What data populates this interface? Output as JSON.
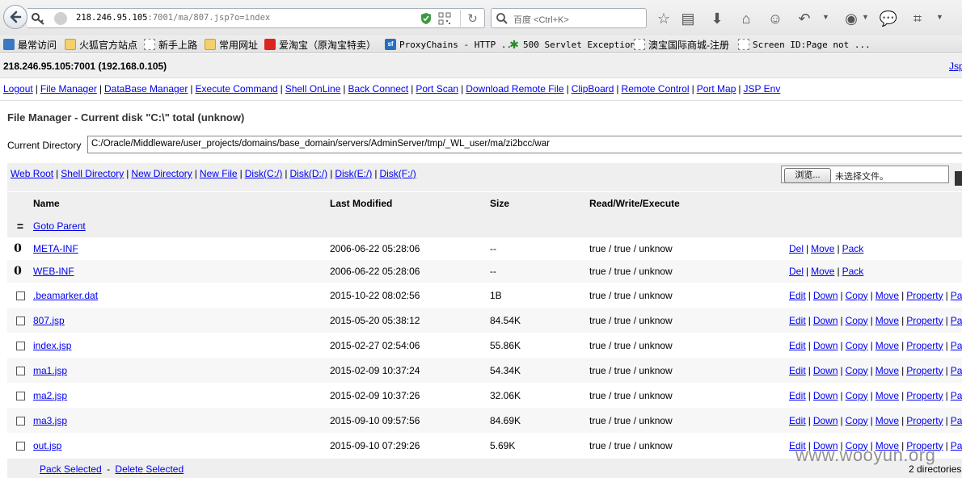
{
  "browser": {
    "url_host": "218.246.95.105",
    "url_rest": ":7001/ma/807.jsp?o=index",
    "search_placeholder": "百度 <Ctrl+K>"
  },
  "bookmarks": [
    {
      "label": "最常访问",
      "icon": "star-icon"
    },
    {
      "label": "火狐官方站点",
      "icon": "folder-icon"
    },
    {
      "label": "新手上路",
      "icon": "page-icon"
    },
    {
      "label": "常用网址",
      "icon": "folder-icon"
    },
    {
      "label": "爱淘宝（原淘宝特卖）",
      "icon": "taobao-icon"
    },
    {
      "label": "ProxyChains - HTTP ...",
      "icon": "sourceforge-icon"
    },
    {
      "label": "500 Servlet Exception",
      "icon": "gear-icon"
    },
    {
      "label": "澳宝国际商城-注册",
      "icon": "page-icon"
    },
    {
      "label": "Screen ID:Page not ...",
      "icon": "page-icon"
    }
  ],
  "page": {
    "host": "218.246.95.105:7001 (192.168.0.105)",
    "corner_link": "Jsp",
    "nav": [
      "Logout",
      "File Manager",
      "DataBase Manager",
      "Execute Command",
      "Shell OnLine",
      "Back Connect",
      "Port Scan",
      "Download Remote File",
      "ClipBoard",
      "Remote Control",
      "Port Map",
      "JSP Env"
    ],
    "title": "File Manager - Current disk \"C:\\\" total (unknow)",
    "current_dir_label": "Current Directory",
    "current_dir": "C:/Oracle/Middleware/user_projects/domains/base_domain/servers/AdminServer/tmp/_WL_user/ma/zi2bcc/war",
    "dir_links": [
      "Web Root",
      "Shell Directory",
      "New Directory",
      "New File",
      "Disk(C:/)",
      "Disk(D:/)",
      "Disk(E:/)",
      "Disk(F:/)"
    ],
    "upload": {
      "browse": "浏览...",
      "no_file": "未选择文件。"
    },
    "columns": [
      "Name",
      "Last Modified",
      "Size",
      "Read/Write/Execute"
    ],
    "parent": {
      "mark": "=",
      "label": "Goto Parent"
    },
    "dirs": [
      {
        "mark": "0",
        "name": "META-INF",
        "modified": "2006-06-22 05:28:06",
        "size": "--",
        "rwx": "true / true / unknow",
        "actions": [
          "Del",
          "Move",
          "Pack"
        ]
      },
      {
        "mark": "0",
        "name": "WEB-INF",
        "modified": "2006-06-22 05:28:06",
        "size": "--",
        "rwx": "true / true / unknow",
        "actions": [
          "Del",
          "Move",
          "Pack"
        ]
      }
    ],
    "files": [
      {
        "name": ".beamarker.dat",
        "modified": "2015-10-22 08:02:56",
        "size": "1B",
        "rwx": "true / true / unknow"
      },
      {
        "name": "807.jsp",
        "modified": "2015-05-20 05:38:12",
        "size": "84.54K",
        "rwx": "true / true / unknow"
      },
      {
        "name": "index.jsp",
        "modified": "2015-02-27 02:54:06",
        "size": "55.86K",
        "rwx": "true / true / unknow"
      },
      {
        "name": "ma1.jsp",
        "modified": "2015-02-09 10:37:24",
        "size": "54.34K",
        "rwx": "true / true / unknow"
      },
      {
        "name": "ma2.jsp",
        "modified": "2015-02-09 10:37:26",
        "size": "32.06K",
        "rwx": "true / true / unknow"
      },
      {
        "name": "ma3.jsp",
        "modified": "2015-09-10 09:57:56",
        "size": "84.69K",
        "rwx": "true / true / unknow"
      },
      {
        "name": "out.jsp",
        "modified": "2015-09-10 07:29:26",
        "size": "5.69K",
        "rwx": "true / true / unknow"
      }
    ],
    "file_actions": [
      "Edit",
      "Down",
      "Copy",
      "Move",
      "Property",
      "Pa"
    ],
    "footer": {
      "pack": "Pack Selected",
      "dash": "-",
      "delete": "Delete Selected",
      "count": "2 directories"
    },
    "watermark": "www.wooyun.org"
  }
}
